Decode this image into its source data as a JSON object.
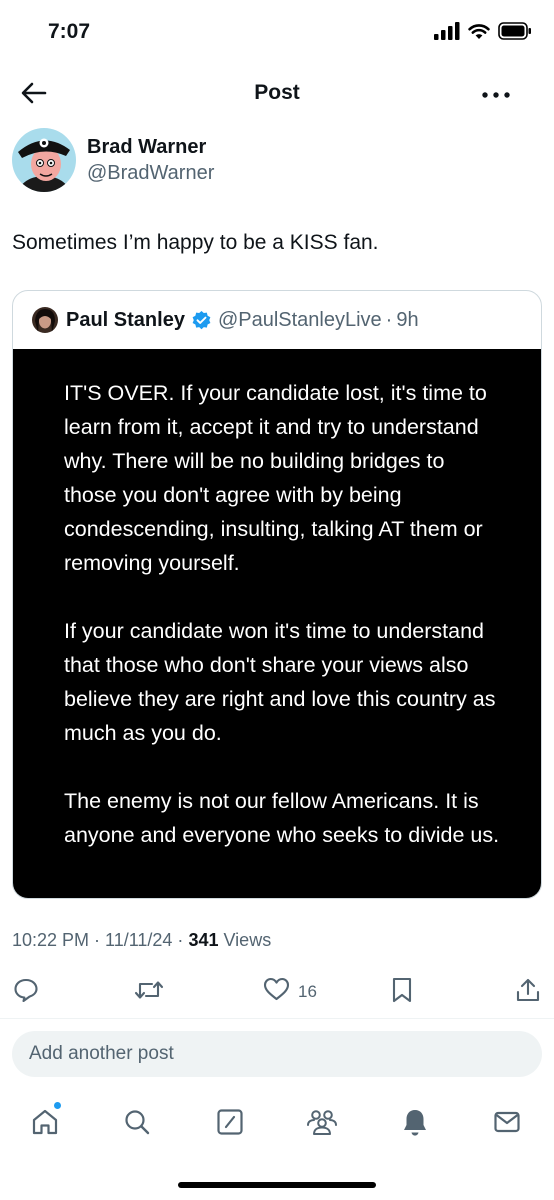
{
  "status_bar": {
    "time": "7:07",
    "signal_icon": "cellular-signal-icon",
    "wifi_icon": "wifi-icon",
    "battery_icon": "battery-icon"
  },
  "nav": {
    "title": "Post",
    "back_icon": "back-arrow-icon",
    "more_icon": "more-icon"
  },
  "post": {
    "author_name": "Brad Warner",
    "author_handle": "@BradWarner",
    "text": "Sometimes I’m happy to be a KISS fan.",
    "timestamp": "10:22 PM · 11/11/24 ·",
    "views_count": "341",
    "views_label": " Views"
  },
  "quoted_post": {
    "author_name": "Paul Stanley",
    "verified": true,
    "author_handle": "@PaulStanleyLive",
    "separator": "·",
    "time": "9h",
    "paragraphs": [
      "IT'S OVER. If your candidate lost, it's time to learn from it, accept it and try to understand why. There will be no building bridges to those you don't agree with by being condescending, insulting, talking AT them or removing yourself.",
      "If your candidate won it's time to understand that those who don't share your views also believe they are right and love this country as much as you do.",
      "The enemy is not our fellow Americans. It is anyone and everyone who seeks to divide us."
    ]
  },
  "actions": {
    "reply_icon": "reply-icon",
    "repost_icon": "repost-icon",
    "like_icon": "heart-icon",
    "like_count": "16",
    "bookmark_icon": "bookmark-icon",
    "share_icon": "share-icon"
  },
  "reply_box": {
    "placeholder": "Add another post"
  },
  "tab_bar": {
    "items": [
      "home-icon",
      "search-icon",
      "grok-icon",
      "communities-icon",
      "notifications-icon",
      "messages-icon"
    ],
    "home_has_badge": true
  },
  "colors": {
    "accent": "#1d9bf0",
    "text": "#0f1419",
    "secondary_text": "#536471",
    "quote_bg": "#000000"
  }
}
